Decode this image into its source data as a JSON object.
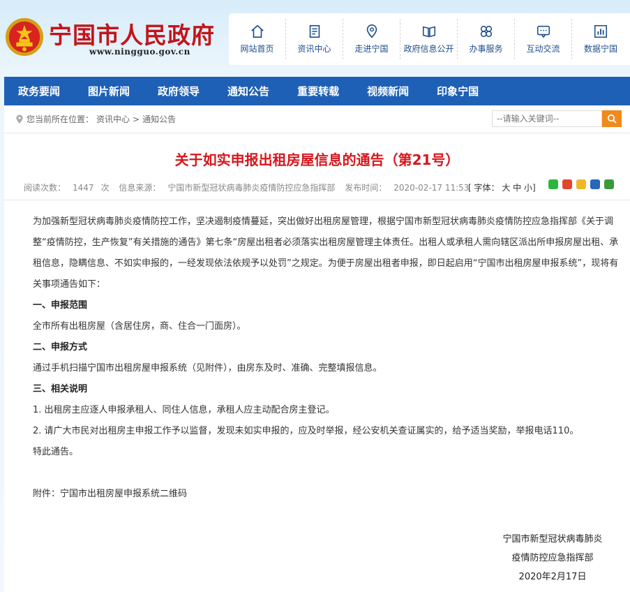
{
  "header": {
    "site_title": "宁国市人民政府",
    "site_url": "www.ningguo.gov.cn",
    "top_nav": [
      {
        "label": "网站首页",
        "icon": "home-icon"
      },
      {
        "label": "资讯中心",
        "icon": "document-icon"
      },
      {
        "label": "走进宁国",
        "icon": "map-pin-icon"
      },
      {
        "label": "政府信息公开",
        "icon": "book-icon"
      },
      {
        "label": "办事服务",
        "icon": "service-icon"
      },
      {
        "label": "互动交流",
        "icon": "chat-icon"
      },
      {
        "label": "数据宁国",
        "icon": "chart-icon"
      }
    ]
  },
  "main_nav": [
    "政务要闻",
    "图片新闻",
    "政府领导",
    "通知公告",
    "重要转载",
    "视频新闻",
    "印象宁国"
  ],
  "breadcrumb": {
    "prefix": "您当前所在位置：",
    "items": [
      "资讯中心",
      "通知公告"
    ],
    "separator": ">"
  },
  "search": {
    "placeholder": "--请输入关键词--"
  },
  "article": {
    "title": "关于如实申报出租房屋信息的通告（第21号）",
    "views_label": "阅读次数：",
    "views": "1447",
    "views_unit": "次",
    "source_label": "信息来源：",
    "source": "宁国市新型冠状病毒肺炎疫情防控应急指挥部",
    "time_label": "发布时间：",
    "time": "2020-02-17 11:53",
    "font_label": "[ 字体：",
    "font_large": "大",
    "font_medium": "中",
    "font_small": "小",
    "font_end": "]",
    "paragraphs": {
      "intro": "为加强新型冠状病毒肺炎疫情防控工作，坚决遏制疫情蔓延，突出做好出租房屋管理，根据宁国市新型冠状病毒肺炎疫情防控应急指挥部《关于调整“疫情防控，生产恢复”有关措施的通告》第七条“房屋出租者必须落实出租房屋管理主体责任。出租人或承租人需向辖区派出所申报房屋出租、承租信息，隐瞒信息、不如实申报的，一经发现依法依规予以处罚”之规定。为便于房屋出租者申报，即日起启用“宁国市出租房屋申报系统”，现将有关事项通告如下：",
      "sec1": "一、申报范围",
      "sec1_text": "全市所有出租房屋（含居住房，商、住合一门面房）。",
      "sec2": "二、申报方式",
      "sec2_text": "通过手机扫描宁国市出租房屋申报系统（见附件），由房东及时、准确、完整填报信息。",
      "sec3": "三、相关说明",
      "item1": "1. 出租房主应逐人申报承租人、同住人信息，承租人应主动配合房主登记。",
      "item2": "2. 请广大市民对出租房主申报工作予以监督，发现未如实申报的，应及时举报，经公安机关查证属实的，给予适当奖励，举报电话110。",
      "closing": "特此通告。",
      "attachment": "附件：宁国市出租房屋申报系统二维码"
    },
    "signature": {
      "line1": "宁国市新型冠状病毒肺炎",
      "line2": "疫情防控应急指挥部",
      "date": "2020年2月17日"
    }
  },
  "colors": {
    "nav_blue": "#1e60b5",
    "title_red": "#d7161c",
    "search_orange": "#f08a1b"
  }
}
